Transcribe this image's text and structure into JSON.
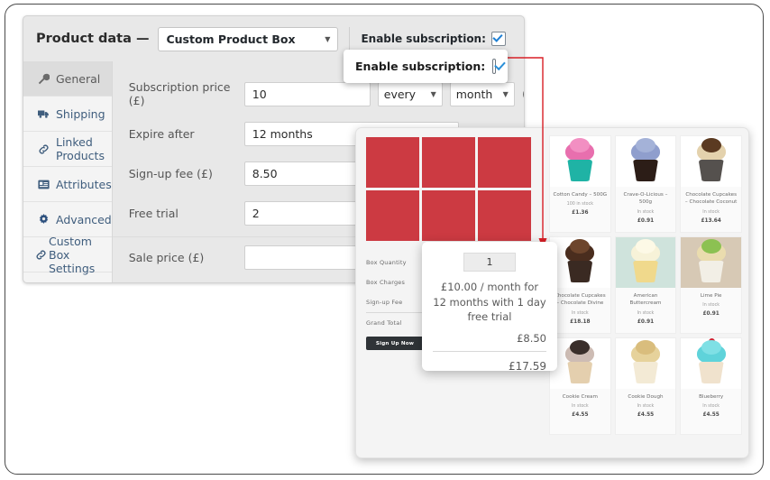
{
  "metabox": {
    "title": "Product data —",
    "product_type": "Custom Product Box",
    "enable_subscription_label": "Enable subscription:",
    "tabs": [
      {
        "label": "General",
        "icon": "wrench-icon"
      },
      {
        "label": "Shipping",
        "icon": "truck-icon"
      },
      {
        "label": "Linked Products",
        "icon": "link-icon"
      },
      {
        "label": "Attributes",
        "icon": "list-icon"
      },
      {
        "label": "Advanced",
        "icon": "gear-icon"
      },
      {
        "label": "Custom Box Settings",
        "icon": "link-icon"
      }
    ],
    "fields": {
      "subscription_price_label": "Subscription price (£)",
      "subscription_price_value": "10",
      "interval_value": "every",
      "period_value": "month",
      "expire_after_label": "Expire after",
      "expire_after_value": "12 months",
      "signup_fee_label": "Sign-up fee (£)",
      "signup_fee_value": "8.50",
      "free_trial_label": "Free trial",
      "free_trial_value": "2",
      "sale_price_label": "Sale price (£)",
      "sale_price_value": "",
      "help_glyph": "?"
    }
  },
  "callout": {
    "label": "Enable subscription:"
  },
  "store": {
    "builder": {
      "summary_rows": [
        "Box Quantity",
        "Box Charges",
        "Sign-up Fee",
        "Grand Total"
      ],
      "signup_button": "Sign Up Now"
    },
    "products": [
      {
        "name": "Cotton Candy – 500G",
        "stock": "100 in stock",
        "price": "£1.36"
      },
      {
        "name": "Crave-O-Licious – 500g",
        "stock": "In stock",
        "price": "£0.91"
      },
      {
        "name": "Chocolate Cupcakes – Chocolate Coconut",
        "stock": "In stock",
        "price": "£13.64"
      },
      {
        "name": "Chocolate Cupcakes – Chocolate Divine",
        "stock": "In stock",
        "price": "£18.18"
      },
      {
        "name": "American Buttercream",
        "stock": "In stock",
        "price": "£0.91"
      },
      {
        "name": "Lime Pie",
        "stock": "In stock",
        "price": "£0.91"
      },
      {
        "name": "Cookie Cream",
        "stock": "In stock",
        "price": "£4.55"
      },
      {
        "name": "Cookie Dough",
        "stock": "In stock",
        "price": "£4.55"
      },
      {
        "name": "Blueberry",
        "stock": "In stock",
        "price": "£4.55"
      }
    ]
  },
  "popup": {
    "quantity": "1",
    "subscription_text": "£10.00 / month for 12 months with 1 day free trial",
    "signup_fee": "£8.50",
    "grand_total": "£17.59"
  },
  "colors": {
    "box_cell": "#cc3a42",
    "callout_arrow": "#d81f26",
    "tab_text": "#3f5d7d",
    "checkbox_tick": "#1d7fd4"
  }
}
